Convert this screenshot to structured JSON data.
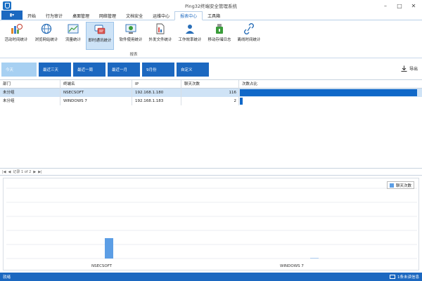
{
  "window": {
    "title": "Ping32终端安全管理系统"
  },
  "menu": {
    "items": [
      "开始",
      "行为审计",
      "桌面管理",
      "网络管理",
      "文档安全",
      "运维中心",
      "报表中心",
      "工具箱"
    ],
    "active_index": 6
  },
  "ribbon": {
    "buttons": [
      {
        "label": "活动时间统计",
        "icon": "activity-time-icon"
      },
      {
        "label": "浏览网站统计",
        "icon": "globe-icon"
      },
      {
        "label": "流量统计",
        "icon": "traffic-chart-icon"
      },
      {
        "label": "即时通讯统计",
        "icon": "im-chat-icon"
      },
      {
        "label": "软件使用统计",
        "icon": "software-icon"
      },
      {
        "label": "外发文件统计",
        "icon": "outgoing-file-icon"
      },
      {
        "label": "工作效率统计",
        "icon": "work-efficiency-icon"
      },
      {
        "label": "移动存储日志",
        "icon": "usb-storage-icon"
      },
      {
        "label": "离线时间统计",
        "icon": "offline-time-icon"
      }
    ],
    "active_index": 3,
    "group_label": "报表"
  },
  "time_tabs": {
    "items": [
      "今天",
      "最近三天",
      "最近一周",
      "最近一月",
      "9月份",
      "自定义"
    ],
    "selected_index": 0,
    "export_label": "导出"
  },
  "grid": {
    "columns": [
      "部门",
      "终端名",
      "IP",
      "聊天次数",
      "次数占比"
    ],
    "rows": [
      {
        "dept": "未分组",
        "terminal": "NSECSOFT",
        "ip": "192.168.1.180",
        "count": "116",
        "ratio": 0.983
      },
      {
        "dept": "未分组",
        "terminal": "WINDOWS 7",
        "ip": "192.168.1.183",
        "count": "2",
        "ratio": 0.017
      }
    ],
    "selected_row": 0
  },
  "pager": {
    "record_text": "记录 1 of 2"
  },
  "chart_data": {
    "type": "bar",
    "categories": [
      "NSECSOFT",
      "WINDOWS 7"
    ],
    "series": [
      {
        "name": "聊天次数",
        "values": [
          116,
          2
        ]
      }
    ],
    "ylim": [
      0,
      400
    ],
    "grid": true,
    "legend": "top-right",
    "color": "#5c9ee5"
  },
  "status": {
    "left": "就绪",
    "right": "1条未读信息"
  },
  "colors": {
    "accent": "#1c68c0",
    "bar": "#1068c8",
    "selected_row": "#cfe3f6"
  }
}
